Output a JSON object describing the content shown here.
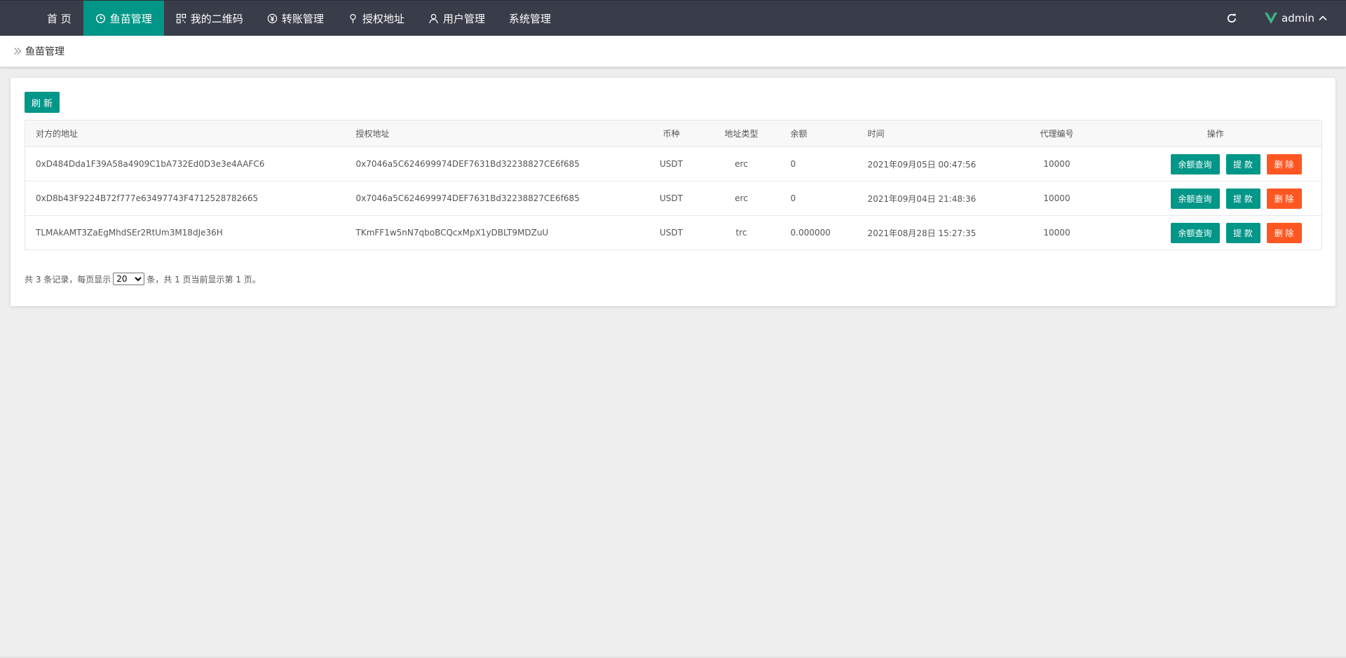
{
  "nav": {
    "items": [
      {
        "label": "首 页",
        "icon": "",
        "active": false
      },
      {
        "label": "鱼苗管理",
        "icon": "clock-icon",
        "active": true
      },
      {
        "label": "我的二维码",
        "icon": "qrcode-icon",
        "active": false
      },
      {
        "label": "转账管理",
        "icon": "yen-icon",
        "active": false
      },
      {
        "label": "授权地址",
        "icon": "location-icon",
        "active": false
      },
      {
        "label": "用户管理",
        "icon": "user-icon",
        "active": false
      },
      {
        "label": "系统管理",
        "icon": "",
        "active": false
      }
    ],
    "user": "admin"
  },
  "breadcrumb": {
    "label": "鱼苗管理"
  },
  "toolbar": {
    "refresh_label": "刷 新"
  },
  "table": {
    "headers": [
      "对方的地址",
      "授权地址",
      "币种",
      "地址类型",
      "余额",
      "时间",
      "代理编号",
      "操作"
    ],
    "rows": [
      {
        "address": "0xD484Dda1F39A58a4909C1bA732Ed0D3e3e4AAFC6",
        "auth": "0x7046a5C624699974DEF7631Bd32238827CE6f685",
        "coin": "USDT",
        "type": "erc",
        "balance": "0",
        "time": "2021年09月05日 00:47:56",
        "agent": "10000"
      },
      {
        "address": "0xD8b43F9224B72f777e63497743F4712528782665",
        "auth": "0x7046a5C624699974DEF7631Bd32238827CE6f685",
        "coin": "USDT",
        "type": "erc",
        "balance": "0",
        "time": "2021年09月04日 21:48:36",
        "agent": "10000"
      },
      {
        "address": "TLMAkAMT3ZaEgMhdSEr2RtUm3M18dJe36H",
        "auth": "TKmFF1w5nN7qboBCQcxMpX1yDBLT9MDZuU",
        "coin": "USDT",
        "type": "trc",
        "balance": "0.000000",
        "time": "2021年08月28日 15:27:35",
        "agent": "10000"
      }
    ],
    "actions": {
      "query": "余额查询",
      "withdraw": "提 款",
      "delete": "删 除"
    }
  },
  "pager": {
    "prefix": "共 3 条记录，每页显示",
    "page_size": "20",
    "suffix": "条，共 1 页当前显示第 1 页。"
  },
  "colors": {
    "primary": "#009688",
    "danger": "#ff5722",
    "nav_bg": "#393d49"
  }
}
